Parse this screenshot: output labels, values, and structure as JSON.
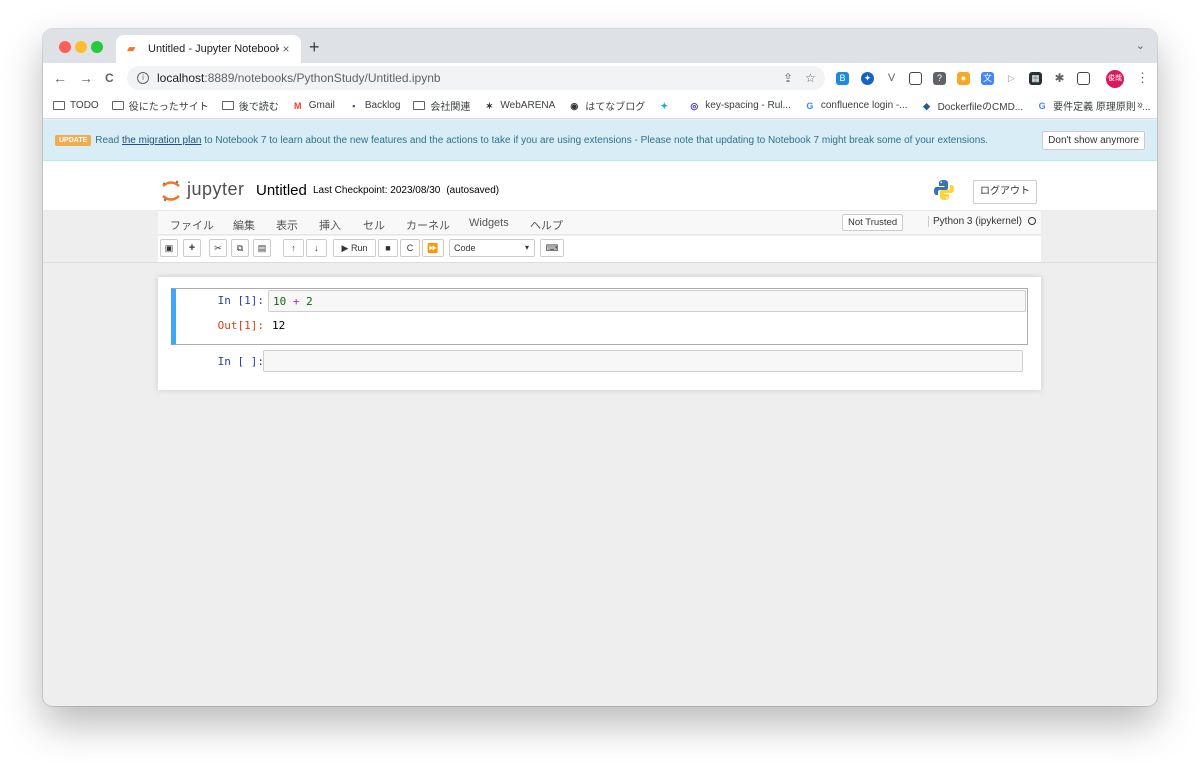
{
  "browser": {
    "tab_title": "Untitled - Jupyter Notebook",
    "tab_close": "×",
    "new_tab": "+",
    "tab_menu": "⌄",
    "back": "←",
    "forward": "→",
    "reload": "C",
    "url_host": "localhost",
    "url_path": ":8889/notebooks/PythonStudy/Untitled.ipynb",
    "share": "⇪",
    "star": "☆",
    "profile_label": "俊哉",
    "menu": "⋮",
    "bookmarks_more": "»",
    "bookmarks": [
      {
        "label": "TODO",
        "icon": "folder-icon"
      },
      {
        "label": "役にたったサイト",
        "icon": "folder-icon"
      },
      {
        "label": "後で読む",
        "icon": "folder-icon"
      },
      {
        "label": "Gmail",
        "icon": "gmail-icon"
      },
      {
        "label": "Backlog",
        "icon": "backlog-icon"
      },
      {
        "label": "会社関連",
        "icon": "folder-icon"
      },
      {
        "label": "WebARENA",
        "icon": "webarena-icon"
      },
      {
        "label": "はてなブログ",
        "icon": "hatena-icon"
      },
      {
        "label": "",
        "icon": "twitter-icon"
      },
      {
        "label": "key-spacing - Rul...",
        "icon": "eslint-icon"
      },
      {
        "label": "confluence login -...",
        "icon": "google-icon"
      },
      {
        "label": "DockerfileのCMD...",
        "icon": "docker-icon"
      },
      {
        "label": "要件定義 原理原則 -...",
        "icon": "google-icon"
      }
    ]
  },
  "banner": {
    "badge": "UPDATE",
    "pre": "Read ",
    "link": "the migration plan",
    "post": " to Notebook 7 to learn about the new features and the actions to take if you are using extensions - Please note that updating to Notebook 7 might break some of your extensions.",
    "dismiss": "Don't show anymore"
  },
  "header": {
    "logo_text": "jupyter",
    "title": "Untitled",
    "checkpoint": "Last Checkpoint: 2023/08/30",
    "autosave": "(autosaved)",
    "logout": "ログアウト"
  },
  "menubar": {
    "items": [
      "ファイル",
      "編集",
      "表示",
      "挿入",
      "セル",
      "カーネル",
      "Widgets",
      "ヘルプ"
    ],
    "trusted": "Not Trusted",
    "kernel": "Python 3 (ipykernel)"
  },
  "toolbar": {
    "run_label": "▶ Run",
    "cell_type": "Code"
  },
  "cells": [
    {
      "in_prompt": "In [1]:",
      "code_a": "10",
      "code_op": " + ",
      "code_b": "2",
      "out_prompt": "Out[1]:",
      "output": "12"
    },
    {
      "in_prompt": "In [ ]:",
      "code": ""
    }
  ],
  "colors": {
    "selected_border": "#42a5f5",
    "in_prompt": "#303f9f",
    "out_prompt": "#d84315",
    "number": "#116611",
    "operator": "#aa22ff"
  }
}
